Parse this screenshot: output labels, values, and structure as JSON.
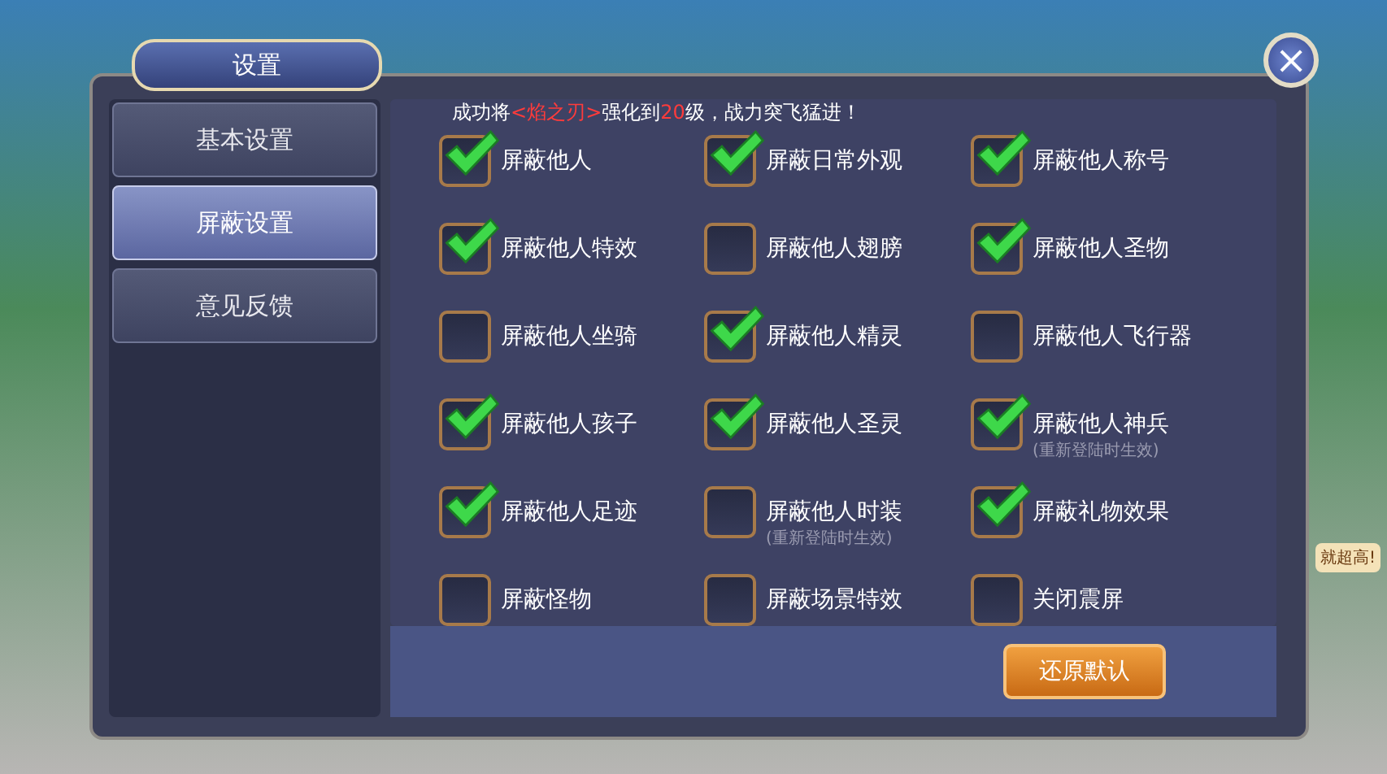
{
  "window": {
    "title": "设置",
    "close": "×"
  },
  "banner": [
    {
      "text": "成功将",
      "kind": "plain"
    },
    {
      "text": "<",
      "kind": "highlight"
    },
    {
      "text": "焰之刃>",
      "kind": "highlight"
    },
    {
      "text": "强化到",
      "kind": "plain"
    },
    {
      "text": "20",
      "kind": "highlight"
    },
    {
      "text": "级，战力突飞猛进！",
      "kind": "plain"
    }
  ],
  "sidebar": {
    "items": [
      {
        "label": "基本设置",
        "selected": false
      },
      {
        "label": "屏蔽设置",
        "selected": true
      },
      {
        "label": "意见反馈",
        "selected": false
      }
    ]
  },
  "options": [
    {
      "label": "屏蔽他人",
      "checked": true
    },
    {
      "label": "屏蔽日常外观",
      "checked": true
    },
    {
      "label": "屏蔽他人称号",
      "checked": true
    },
    {
      "label": "屏蔽他人特效",
      "checked": true
    },
    {
      "label": "屏蔽他人翅膀",
      "checked": false
    },
    {
      "label": "屏蔽他人圣物",
      "checked": true
    },
    {
      "label": "屏蔽他人坐骑",
      "checked": false
    },
    {
      "label": "屏蔽他人精灵",
      "checked": true
    },
    {
      "label": "屏蔽他人飞行器",
      "checked": false
    },
    {
      "label": "屏蔽他人孩子",
      "checked": true
    },
    {
      "label": "屏蔽他人圣灵",
      "checked": true
    },
    {
      "label": "屏蔽他人神兵",
      "checked": true,
      "note": "(重新登陆时生效)"
    },
    {
      "label": "屏蔽他人足迹",
      "checked": true
    },
    {
      "label": "屏蔽他人时装",
      "checked": false,
      "note": "(重新登陆时生效)"
    },
    {
      "label": "屏蔽礼物效果",
      "checked": true
    },
    {
      "label": "屏蔽怪物",
      "checked": false
    },
    {
      "label": "屏蔽场景特效",
      "checked": false
    },
    {
      "label": "关闭震屏",
      "checked": false
    }
  ],
  "reset_button": "还原默认",
  "side_bubble": "就超高!"
}
